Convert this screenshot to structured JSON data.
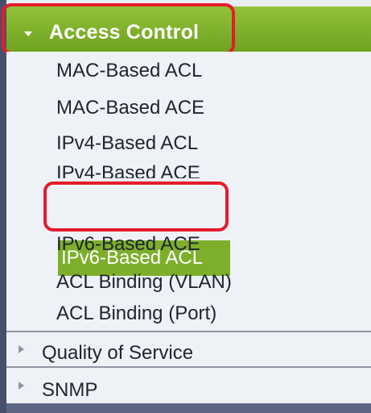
{
  "menu": {
    "header": {
      "label": "Access Control"
    },
    "items": [
      {
        "label": "MAC-Based ACL"
      },
      {
        "label": "MAC-Based ACE"
      },
      {
        "label": "IPv4-Based ACL"
      },
      {
        "label": "IPv4-Based ACE"
      },
      {
        "label": "IPv6-Based ACL",
        "selected": true
      },
      {
        "label": "IPv6-Based ACE"
      },
      {
        "label": "ACL Binding (VLAN)"
      },
      {
        "label": "ACL Binding (Port)"
      }
    ],
    "sections": [
      {
        "label": "Quality of Service"
      },
      {
        "label": "SNMP"
      }
    ]
  },
  "colors": {
    "header_green": "#7daf2b",
    "highlight_red": "#e61b2c",
    "text": "#1f2430"
  }
}
